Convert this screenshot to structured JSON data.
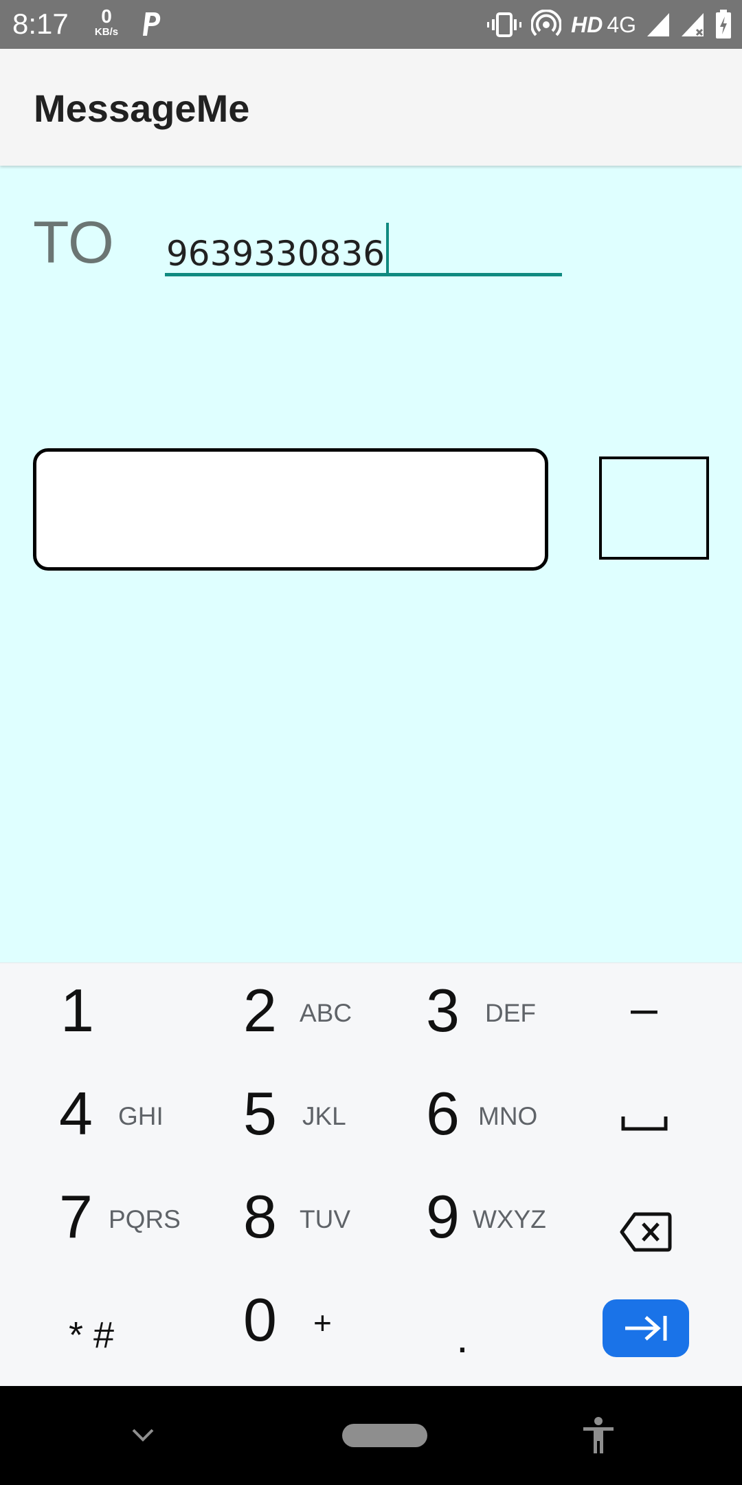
{
  "status_bar": {
    "time": "8:17",
    "net_speed_value": "0",
    "net_speed_unit": "KB/s",
    "hd_label": "HD",
    "network_label": "4G"
  },
  "app_bar": {
    "title": "MessageMe"
  },
  "compose": {
    "to_label": "TO",
    "phone_value": "9639330836",
    "message_value": ""
  },
  "keyboard": {
    "keys": [
      {
        "digit": "1",
        "letters": ""
      },
      {
        "digit": "2",
        "letters": "ABC"
      },
      {
        "digit": "3",
        "letters": "DEF"
      },
      {
        "digit": "4",
        "letters": "GHI"
      },
      {
        "digit": "5",
        "letters": "JKL"
      },
      {
        "digit": "6",
        "letters": "MNO"
      },
      {
        "digit": "7",
        "letters": "PQRS"
      },
      {
        "digit": "8",
        "letters": "TUV"
      },
      {
        "digit": "9",
        "letters": "WXYZ"
      },
      {
        "digit": "0",
        "letters": "+"
      }
    ],
    "star_hash": "* #",
    "dash": "–",
    "period": ".",
    "accent_color": "#1a73e8"
  },
  "colors": {
    "content_background": "#dfffff",
    "field_underline": "#108a80"
  }
}
